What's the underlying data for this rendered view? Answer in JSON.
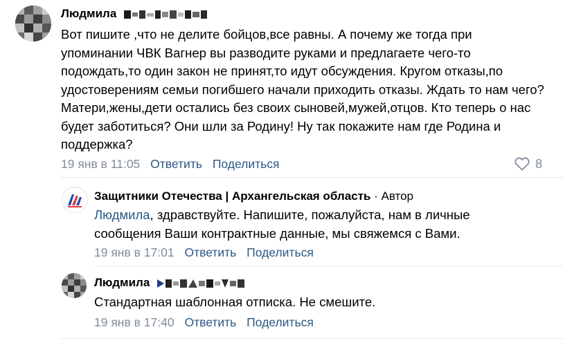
{
  "comments": [
    {
      "author": "Людмила",
      "author_censored": true,
      "text": "Вот пишите ,что не делите бойцов,все равны. А почему же тогда при упоминании ЧВК Вагнер вы разводите руками и предлагаете чего-то подождать,то один закон не принят,то идут обсуждения. Кругом отказы,по удостоверениям семьи погибшего начали приходить отказы. Ждать то нам чего? Матери,жены,дети остались без своих сыновей,мужей,отцов. Кто теперь о нас будет заботиться? Они шли за Родину! Ну так покажите нам где Родина и поддержка?",
      "time": "19 янв в 11:05",
      "reply_label": "Ответить",
      "share_label": "Поделиться",
      "likes": "8"
    },
    {
      "author": "Защитники Отечества | Архангельская область",
      "author_suffix": " · Автор",
      "mention": "Людмила",
      "text": ", здравствуйте. Напишите, пожалуйста, нам в личные сообщения Ваши контрактные данные, мы свяжемся с Вами.",
      "time": "19 янв в 17:01",
      "reply_label": "Ответить",
      "share_label": "Поделиться"
    },
    {
      "author": "Людмила",
      "author_censored": true,
      "text": "Стандартная шаблонная отписка. Не смешите.",
      "time": "19 янв в 17:40",
      "reply_label": "Ответить",
      "share_label": "Поделиться"
    }
  ],
  "colors": {
    "link": "#2a5885",
    "meta": "#818c99",
    "divider": "#e7e8ec",
    "logo_red": "#e03a3e",
    "logo_blue": "#1f4aa8"
  },
  "icons": {
    "like": "heart-outline-icon",
    "avatar": "pixelated-avatar",
    "org_logo": "defenders-fund-logo"
  }
}
